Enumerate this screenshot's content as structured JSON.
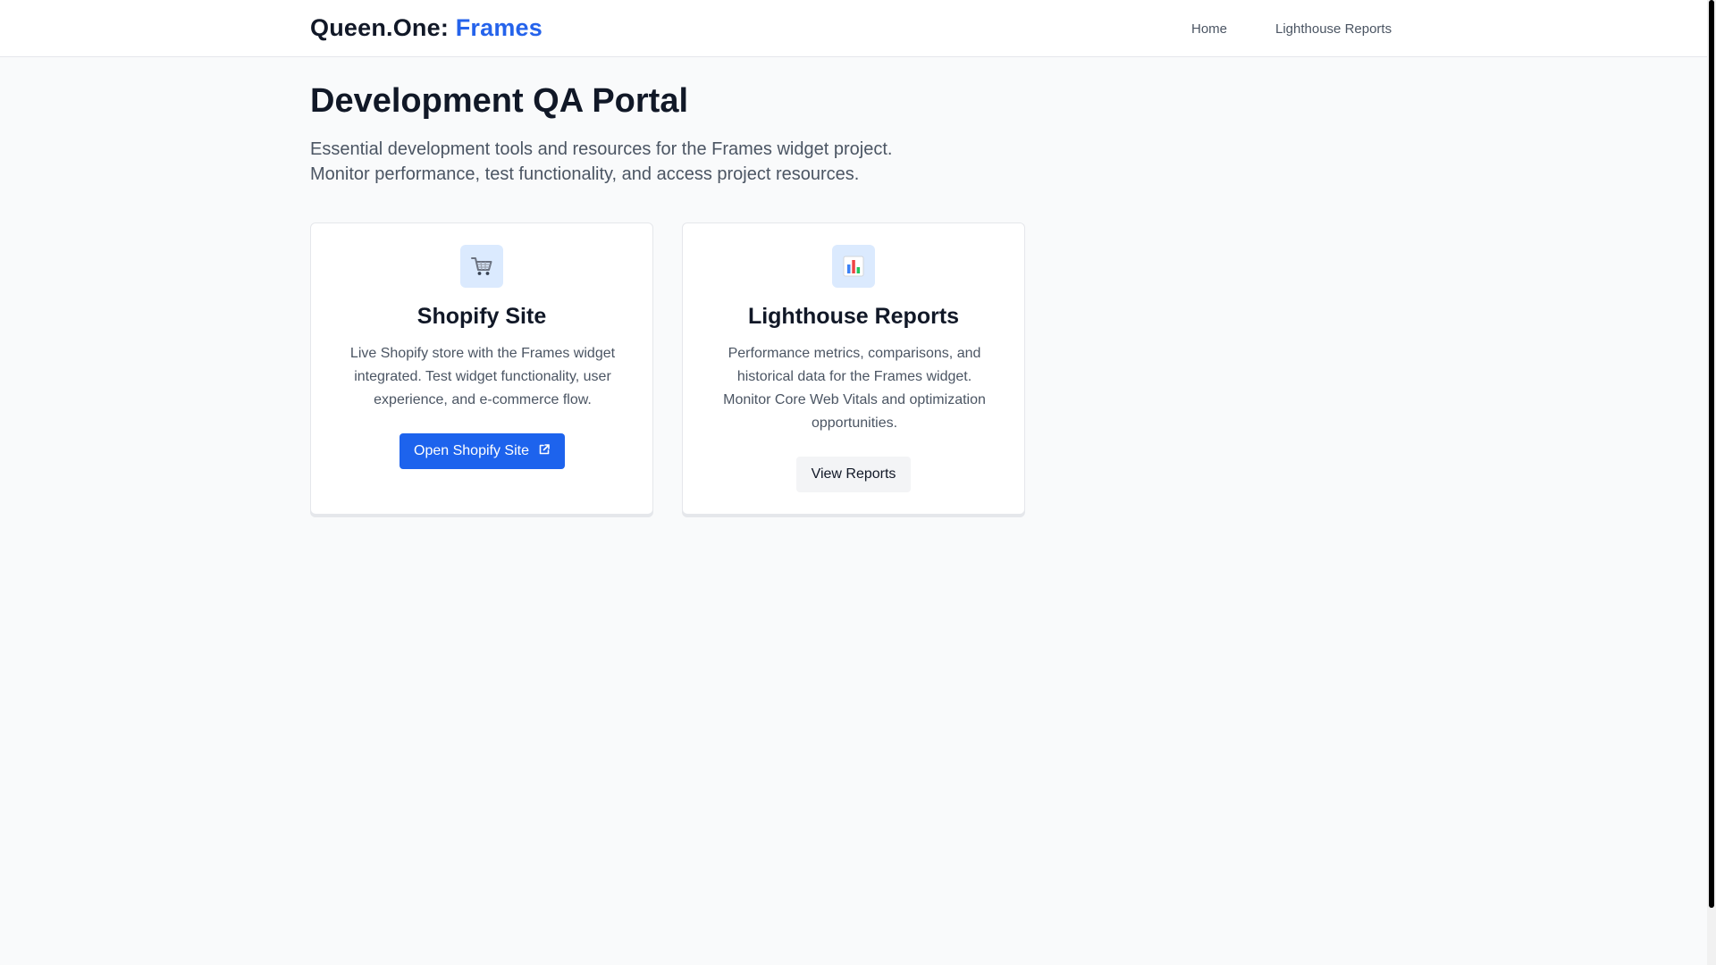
{
  "header": {
    "brand_prefix": "Queen.One:",
    "brand_accent": "Frames",
    "nav": [
      {
        "label": "Home"
      },
      {
        "label": "Lighthouse Reports"
      }
    ]
  },
  "main": {
    "title": "Development QA Portal",
    "description_line1": "Essential development tools and resources for the Frames widget project.",
    "description_line2": "Monitor performance, test functionality, and access project resources."
  },
  "cards": [
    {
      "icon": "shopping-cart-icon",
      "title": "Shopify Site",
      "description": "Live Shopify store with the Frames widget integrated. Test widget functionality, user experience, and e-commerce flow.",
      "button_label": "Open Shopify Site",
      "button_icon": "external-link-icon"
    },
    {
      "icon": "bar-chart-icon",
      "title": "Lighthouse Reports",
      "description": "Performance metrics, comparisons, and historical data for the Frames widget. Monitor Core Web Vitals and optimization opportunities.",
      "button_label": "View Reports"
    }
  ],
  "colors": {
    "accent": "#2563eb",
    "primary_button": "#1d63ed",
    "icon_tile": "#dbeafe"
  }
}
